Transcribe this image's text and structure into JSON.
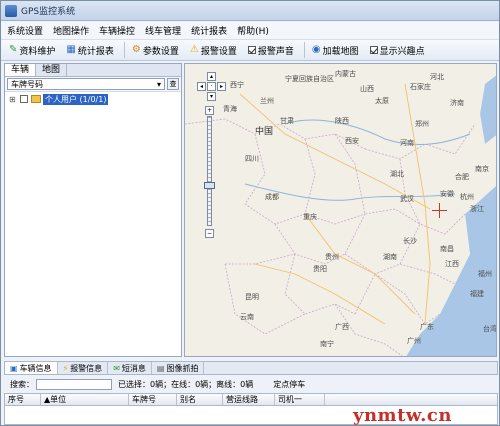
{
  "window": {
    "title": "GPS监控系统"
  },
  "menu": {
    "items": [
      "系统设置",
      "地图操作",
      "车辆操控",
      "线车管理",
      "统计报表",
      "帮助(H)"
    ]
  },
  "toolbar": {
    "buttons": [
      "资料维护",
      "统计报表",
      "参数设置",
      "报警设置",
      "报警声音",
      "加载地图",
      "显示兴趣点"
    ],
    "checkbox_states": {
      "alarm_sound": true,
      "show_poi": true
    }
  },
  "left_panel": {
    "tabs": [
      "车辆",
      "地图"
    ],
    "search_select": "车牌号码",
    "search_button": "查",
    "tree_root": "个人用户 (1/0/1)"
  },
  "map": {
    "labels": [
      "西宁",
      "兰州",
      "宁夏回族自治区",
      "内蒙古",
      "山西",
      "太原",
      "石家庄",
      "河北",
      "济南",
      "郑州",
      "西安",
      "甘肃",
      "青海",
      "四川",
      "陕西",
      "河南",
      "南京",
      "合肥",
      "中国",
      "成都",
      "湖北",
      "武汉",
      "重庆",
      "安徽",
      "浙江",
      "杭州",
      "长沙",
      "湖南",
      "贵阳",
      "贵州",
      "南昌",
      "江西",
      "福州",
      "福建",
      "云南",
      "昆明",
      "广西",
      "南宁",
      "广东",
      "广州",
      "台湾"
    ]
  },
  "bottom_tabs": [
    "车辆信息",
    "报警信息",
    "短消息",
    "图像抓拍"
  ],
  "status": {
    "search_label": "搜索：",
    "stats": "已选择：0辆；在线：0辆；离线：0辆",
    "stop_label": "定点停车"
  },
  "grid": {
    "columns": [
      "序号",
      "▲单位",
      "车牌号",
      "别名",
      "营运线路",
      "司机一"
    ]
  },
  "watermark": "ynmtw.cn",
  "colors": {
    "selected": "#2b63c7",
    "map_bg": "#eeebe2",
    "watermark": "#c3302a"
  }
}
